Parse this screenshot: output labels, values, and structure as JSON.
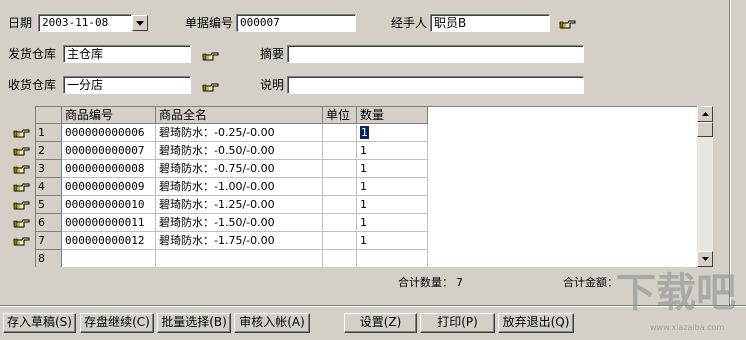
{
  "header": {
    "date_label": "日期",
    "date_value": "2003-11-08",
    "doc_no_label": "单据编号",
    "doc_no_value": "000007",
    "handler_label": "经手人",
    "handler_value": "职员B",
    "ship_wh_label": "发货仓库",
    "ship_wh_value": "主仓库",
    "summary_label": "摘要",
    "summary_value": "",
    "recv_wh_label": "收货仓库",
    "recv_wh_value": "一分店",
    "note_label": "说明",
    "note_value": ""
  },
  "grid": {
    "columns": [
      "商品编号",
      "商品全名",
      "单位",
      "数量"
    ],
    "rows": [
      {
        "no": "1",
        "code": "000000000006",
        "name": "碧琦防水：-0.25/-0.00",
        "unit": "",
        "qty": "1"
      },
      {
        "no": "2",
        "code": "000000000007",
        "name": "碧琦防水：-0.50/-0.00",
        "unit": "",
        "qty": "1"
      },
      {
        "no": "3",
        "code": "000000000008",
        "name": "碧琦防水：-0.75/-0.00",
        "unit": "",
        "qty": "1"
      },
      {
        "no": "4",
        "code": "000000000009",
        "name": "碧琦防水：-1.00/-0.00",
        "unit": "",
        "qty": "1"
      },
      {
        "no": "5",
        "code": "000000000010",
        "name": "碧琦防水：-1.25/-0.00",
        "unit": "",
        "qty": "1"
      },
      {
        "no": "6",
        "code": "000000000011",
        "name": "碧琦防水：-1.50/-0.00",
        "unit": "",
        "qty": "1"
      },
      {
        "no": "7",
        "code": "000000000012",
        "name": "碧琦防水：-1.75/-0.00",
        "unit": "",
        "qty": "1"
      },
      {
        "no": "8",
        "code": "",
        "name": "",
        "unit": "",
        "qty": ""
      }
    ]
  },
  "totals": {
    "qty_label": "合计数量：",
    "qty_value": "7",
    "amount_label": "合计金额："
  },
  "buttons": {
    "save_draft": "存入草稿(S)",
    "save_continue": "存盘继续(C)",
    "batch_select": "批量选择(B)",
    "approve_post": "审核入帐(A)",
    "settings": "设置(Z)",
    "print": "打印(P)",
    "abandon_exit": "放弃退出(Q)"
  },
  "watermark": {
    "logo_text": "下载吧",
    "url": "www.xiazaiba.com"
  },
  "icons": {
    "pointer": "hand-pointer-icon",
    "dropdown": "chevron-down-icon"
  },
  "colors": {
    "window_bg": "#d4d0c8",
    "selection": "#0a246a"
  }
}
